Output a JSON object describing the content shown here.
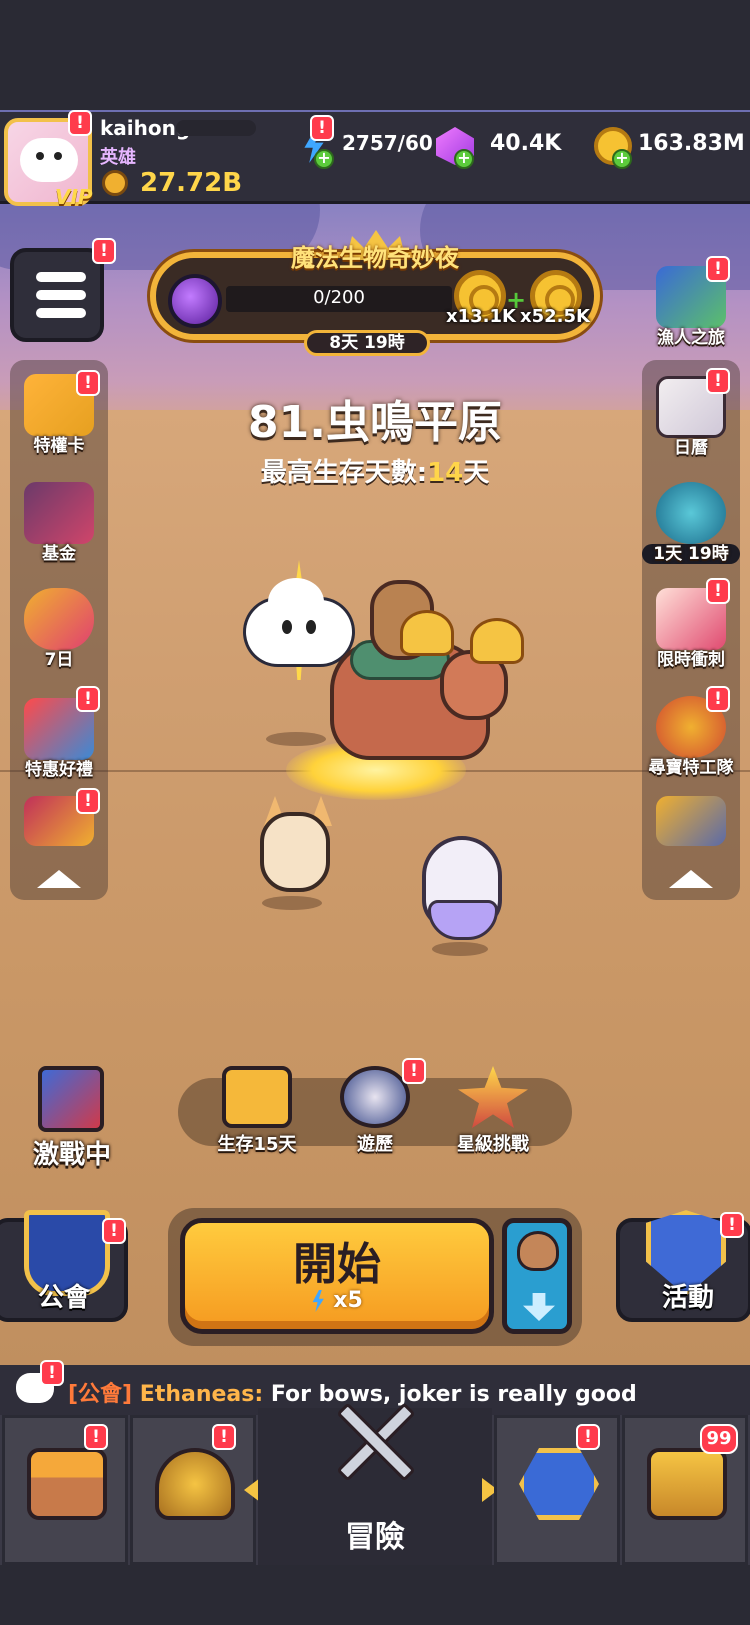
{
  "player": {
    "name": "kaihong",
    "title": "英雄",
    "power": "27.72B",
    "vip_label": "VIP"
  },
  "resources": {
    "energy": "2757/60",
    "gems": "40.4K",
    "gold": "163.83M"
  },
  "event": {
    "title": "魔法生物奇妙夜",
    "progress": "0/200",
    "reward1_mult": "x13.1K",
    "reward2_mult": "x52.5K",
    "timer": "8天 19時"
  },
  "stage": {
    "name": "81.虫鳴平原",
    "survive_prefix": "最高生存天數:",
    "survive_days": "14",
    "survive_suffix": "天"
  },
  "left_menu": [
    {
      "label": "特權卡"
    },
    {
      "label": "基金"
    },
    {
      "label": "7日"
    },
    {
      "label": "特惠好禮"
    }
  ],
  "right_menu": [
    {
      "label": "漁人之旅"
    },
    {
      "label": "日曆"
    },
    {
      "label": "1天 19時"
    },
    {
      "label": "限時衝刺"
    },
    {
      "label": "尋寶特工隊"
    }
  ],
  "modes": {
    "battle": "激戰中",
    "survive": "生存15天",
    "journey": "遊歷",
    "star": "星級挑戰"
  },
  "start": {
    "label": "開始",
    "cost": "x5"
  },
  "guild_label": "公會",
  "activity_label": "活動",
  "chat": {
    "tag": "[公會]",
    "sender": "Ethaneas:",
    "text": "For bows, joker is really good"
  },
  "nav": {
    "center_label": "冒險",
    "chest_count": "99"
  },
  "colors": {
    "accent_gold": "#f2b43a",
    "badge_red": "#ff3b4c",
    "start_orange": "#f59a20",
    "highlight_yellow": "#ffd54a"
  }
}
